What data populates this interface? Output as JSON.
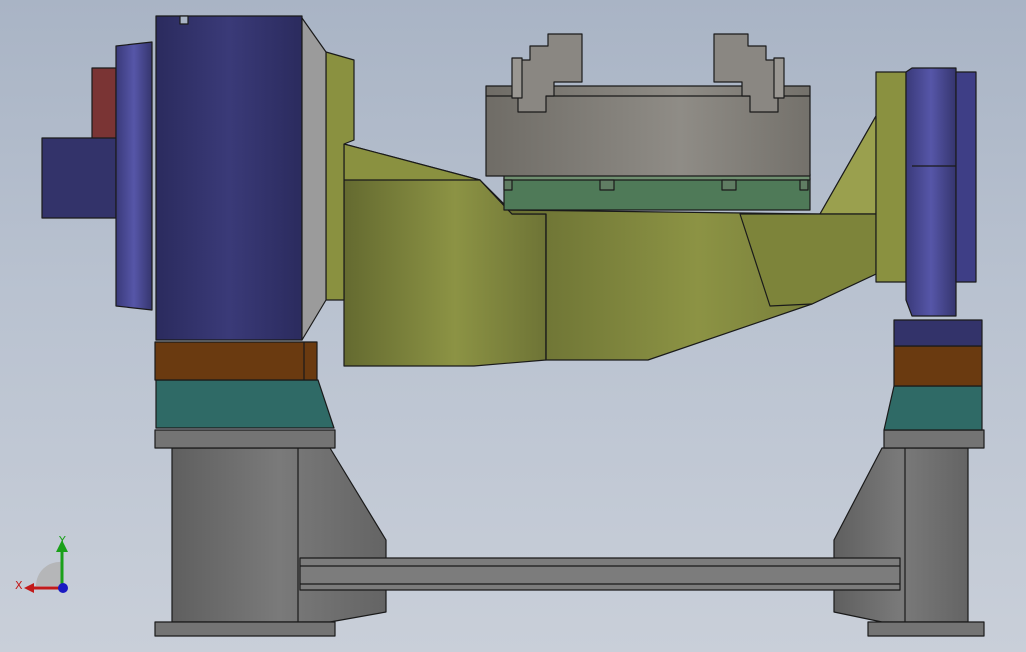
{
  "viewport": {
    "background_top": "#a9b4c5",
    "background_bottom": "#c9cfd9"
  },
  "colors": {
    "motor_blue": "#33336a",
    "motor_blue_light": "#4a4a9a",
    "arm_olive": "#6e7436",
    "arm_olive_light": "#9aa04e",
    "fixture_gray": "#7e7b75",
    "plate_green": "#4f7a58",
    "bearing_brown": "#6a3a10",
    "base_teal": "#2f6a66",
    "stand_gray": "#6f6f6f",
    "flange_red": "#7a3434"
  },
  "triad": {
    "x_label": "X",
    "y_label": "Y",
    "x_color": "#c21a1a",
    "y_color": "#1aa01a",
    "z_color": "#1a1ac2"
  }
}
